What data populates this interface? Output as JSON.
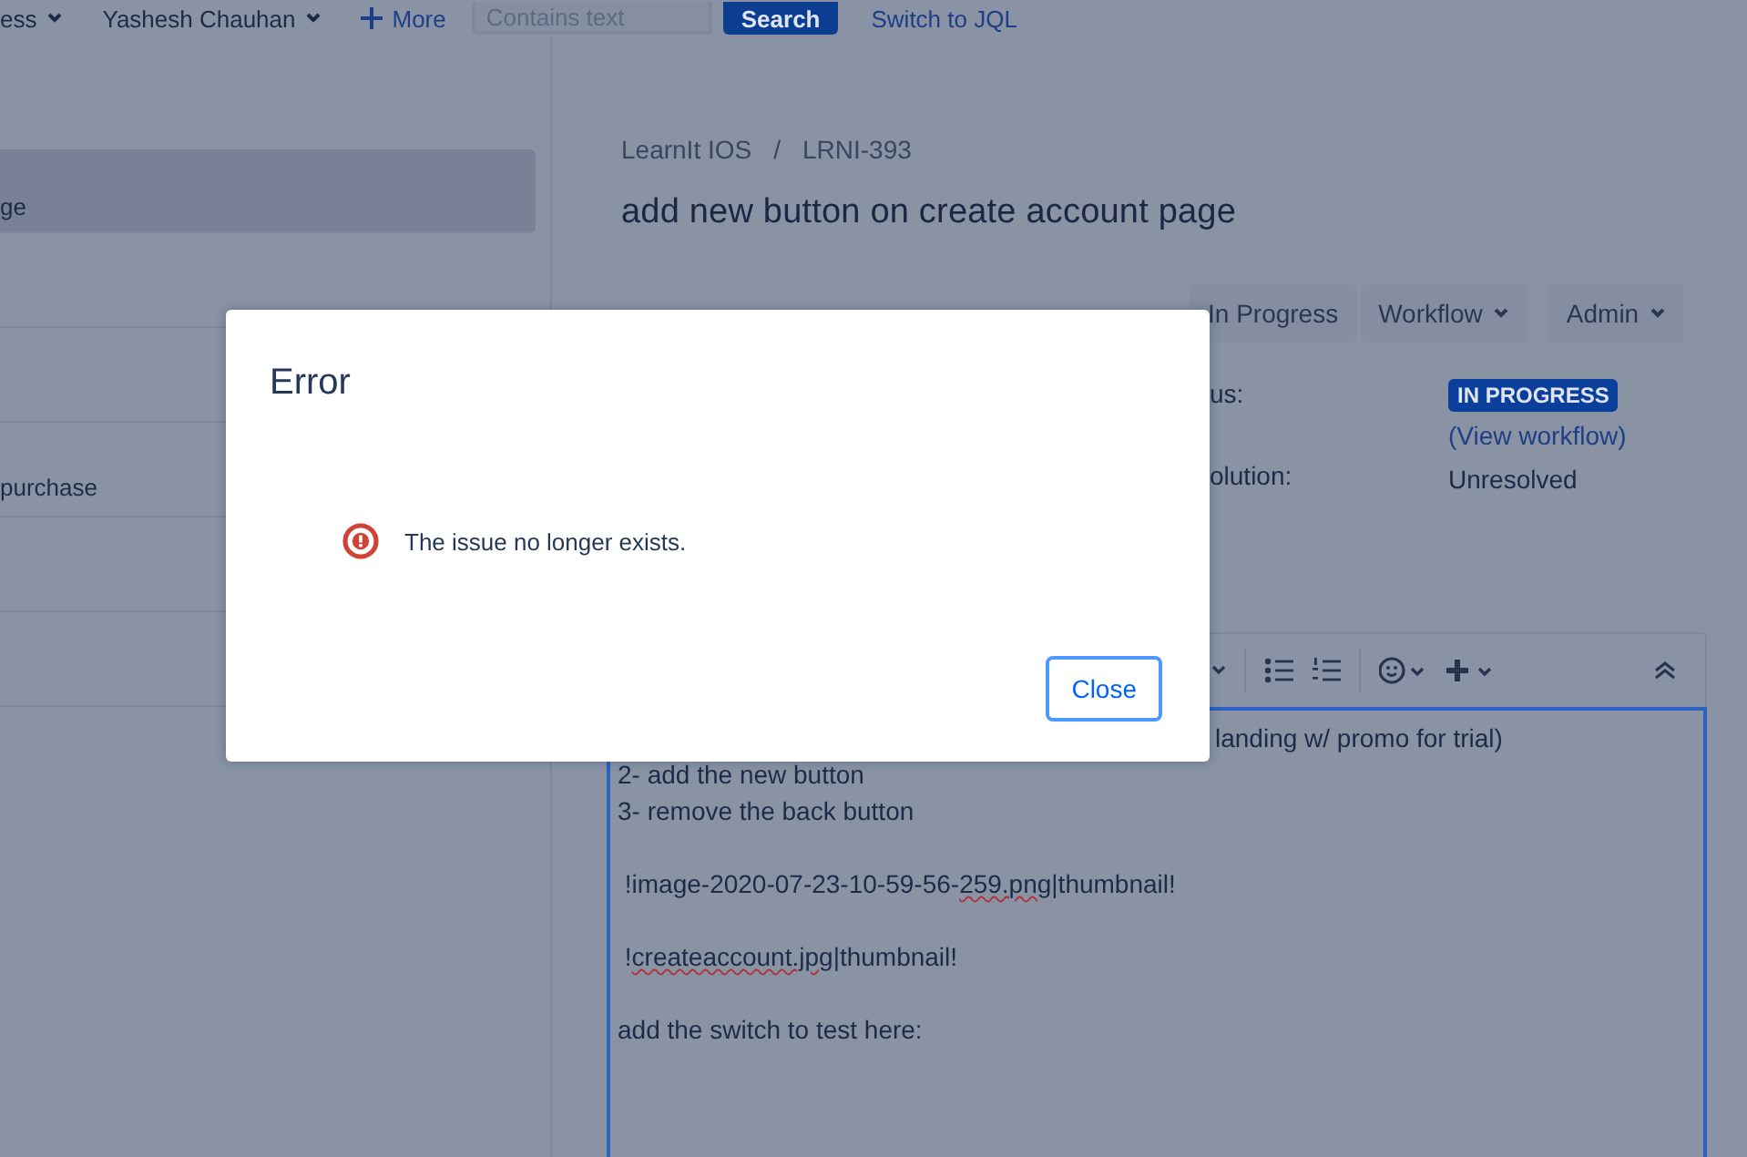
{
  "top_bar": {
    "filters": [
      {
        "label": "ess"
      },
      {
        "label": "Yashesh Chauhan"
      }
    ],
    "more": "More",
    "search_field": {
      "placeholder": "Contains text"
    },
    "search_button": "Search",
    "switch_link": "Switch to JQL"
  },
  "sidebar": {
    "items": [
      {
        "text": "ge",
        "selected": true
      },
      {
        "text": "purchase",
        "selected": false
      }
    ]
  },
  "issue": {
    "breadcrumbs": [
      "LearnIt IOS",
      "LRNI-393"
    ],
    "breadcrumb_separator": "/",
    "title": "add new button on create account page",
    "actions": [
      "In Progress",
      "Workflow",
      "Admin"
    ],
    "fields": [
      {
        "label": "us:",
        "value": "IN PROGRESS",
        "kind": "badge",
        "link": "(View workflow)"
      },
      {
        "label": "olution:",
        "value": "Unresolved",
        "kind": "text"
      }
    ],
    "description_lines": [
      {
        "kind": "text",
        "parts": [
          {
            "text": "landing w/ promo for trial)",
            "misspelled": false
          }
        ]
      },
      {
        "kind": "text",
        "parts": [
          {
            "text": "2- add the new button",
            "misspelled": false
          }
        ]
      },
      {
        "kind": "text",
        "parts": [
          {
            "text": "3- remove the back button",
            "misspelled": false
          }
        ]
      },
      {
        "kind": "blank"
      },
      {
        "kind": "text",
        "parts": [
          {
            "text": " !image-2020-07-23-10-59-56-",
            "misspelled": false
          },
          {
            "text": "259.png",
            "misspelled": true
          },
          {
            "text": "|thumbnail!",
            "misspelled": false
          }
        ]
      },
      {
        "kind": "blank"
      },
      {
        "kind": "text",
        "parts": [
          {
            "text": " !",
            "misspelled": false
          },
          {
            "text": "createaccount.jpg",
            "misspelled": true
          },
          {
            "text": "|thumbnail!",
            "misspelled": false
          }
        ]
      },
      {
        "kind": "blank"
      },
      {
        "kind": "text",
        "parts": [
          {
            "text": "add the switch to test here:",
            "misspelled": false
          }
        ]
      }
    ]
  },
  "dialog": {
    "title": "Error",
    "message": "The issue no longer exists.",
    "button": "Close"
  }
}
